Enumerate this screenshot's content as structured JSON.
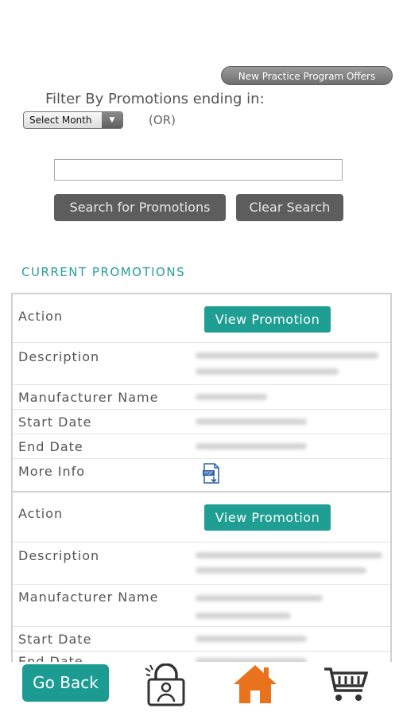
{
  "header": {
    "offers_button": "New Practice Program Offers"
  },
  "filter": {
    "label": "Filter By Promotions ending in:",
    "select_value": "Select Month",
    "or_text": "(OR)",
    "search_value": "",
    "search_button": "Search for Promotions",
    "clear_button": "Clear Search"
  },
  "section": {
    "title": "CURRENT PROMOTIONS"
  },
  "promotions": [
    {
      "labels": {
        "action": "Action",
        "description": "Description",
        "manufacturer": "Manufacturer Name",
        "start": "Start Date",
        "end": "End Date",
        "more_info": "More Info"
      },
      "view_button": "View Promotion"
    },
    {
      "labels": {
        "action": "Action",
        "description": "Description",
        "manufacturer": "Manufacturer Name",
        "start": "Start Date",
        "end": "End Date"
      },
      "view_button": "View Promotion"
    }
  ],
  "bottom_nav": {
    "go_back": "Go Back",
    "icons": [
      "account-lock-icon",
      "home-icon",
      "cart-icon"
    ],
    "home_color": "#e8731c",
    "accent_color": "#1c9b93"
  }
}
